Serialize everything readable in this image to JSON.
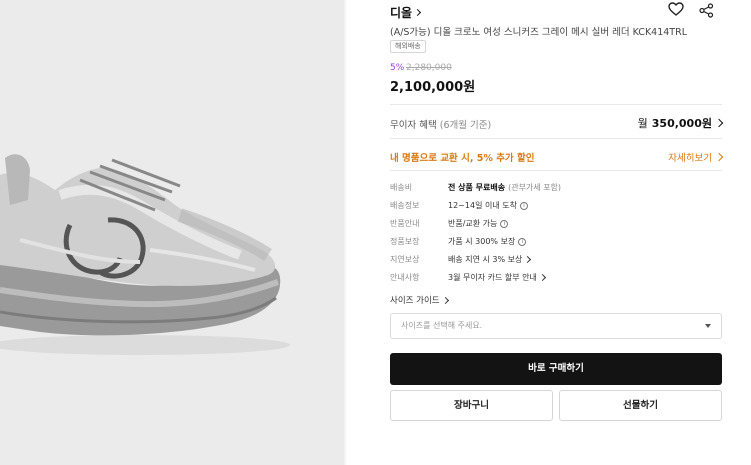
{
  "brand": {
    "name": "디올"
  },
  "product": {
    "title": "(A/S가능) 디올 크로노 여성 스니커즈 그레이 메시 실버 레더 KCK414TRL",
    "badge": "해외배송",
    "discount": "5%",
    "original_price": "2,280,000",
    "sale_price": "2,100,000원"
  },
  "installment": {
    "label": "무이자 혜택",
    "sub": "(6개월 기준)",
    "prefix": "월",
    "amount": "350,000원"
  },
  "promo": {
    "text": "내 명품으로 교환 시, 5% 추가 할인",
    "link": "자세히보기"
  },
  "info_rows": [
    {
      "label": "배송비",
      "value": "전 상품 무료배송",
      "extra": "(관부가세 포함)"
    },
    {
      "label": "배송정보",
      "value": "12~14일 이내 도착"
    },
    {
      "label": "반품안내",
      "value": "반품/교환 가능"
    },
    {
      "label": "정품보장",
      "value": "가품 시 300% 보장"
    },
    {
      "label": "지연보상",
      "value": "배송 지연 시 3% 보상"
    },
    {
      "label": "안내사항",
      "value": "3월 무이자 카드 할부 안내"
    }
  ],
  "size_guide": "사이즈 가이드",
  "size_select": {
    "placeholder": "사이즈를 선택해 주세요."
  },
  "buttons": {
    "buy": "바로 구매하기",
    "cart": "장바구니",
    "gift": "선물하기"
  },
  "colors": {
    "promo": "#d97a12",
    "discount": "#9a3fd6",
    "primary_button": "#131313"
  },
  "icons": [
    "heart-icon",
    "share-icon",
    "chevron-right-icon",
    "info-circle-icon",
    "chevron-down-icon"
  ]
}
